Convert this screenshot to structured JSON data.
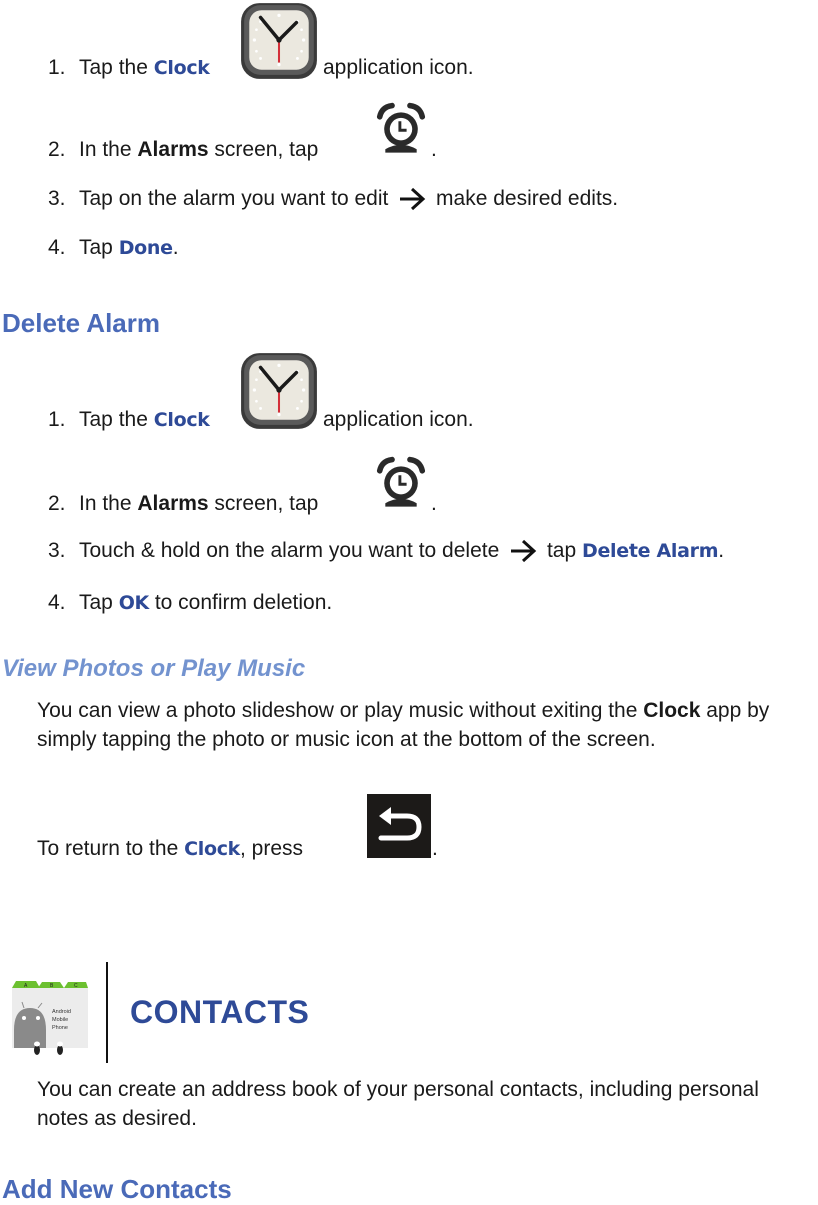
{
  "edit_alarm_steps": [
    {
      "num": "1.",
      "pre": "Tap the ",
      "key": "Clock",
      "icon": "clock-app-icon",
      "post": " application icon."
    },
    {
      "num": "2.",
      "pre": "In the ",
      "bold": "Alarms",
      "mid": " screen, tap ",
      "icon": "alarm-clock-icon",
      "post": "."
    },
    {
      "num": "3.",
      "pre": "Tap on the alarm you want to edit ",
      "icon": "arrow-right-icon",
      "post": " make desired edits."
    },
    {
      "num": "4.",
      "pre": "Tap ",
      "key": "Done",
      "post": "."
    }
  ],
  "delete_alarm": {
    "heading": "Delete Alarm",
    "steps": [
      {
        "num": "1.",
        "pre": "Tap the ",
        "key": "Clock",
        "icon": "clock-app-icon",
        "post": " application icon."
      },
      {
        "num": "2.",
        "pre": "In the ",
        "bold": "Alarms",
        "mid": " screen, tap ",
        "icon": "alarm-clock-icon",
        "post": "."
      },
      {
        "num": "3.",
        "pre": "Touch & hold on the alarm you want to delete ",
        "icon": "arrow-right-icon",
        "mid": " tap ",
        "key": "Delete Alarm",
        "post": "."
      },
      {
        "num": "4.",
        "pre": "Tap ",
        "key": "OK",
        "post": " to confirm deletion."
      }
    ]
  },
  "view_photos": {
    "heading": "View Photos or Play Music",
    "para_pre": "You can view a photo slideshow or play music without exiting the ",
    "para_bold": "Clock",
    "para_post": " app by simply tapping the photo or music icon at the bottom of the screen.",
    "return_pre": "To return to the ",
    "return_key": "Clock",
    "return_mid": ", press ",
    "return_icon": "back-button-icon",
    "return_post": "."
  },
  "contacts": {
    "title": "CONTACTS",
    "icon": "contacts-app-icon",
    "icon_tabs": [
      "A",
      "B",
      "C"
    ],
    "icon_label": [
      "Android",
      "Mobile",
      "Phone"
    ],
    "para": "You can create an address book of your personal contacts, including personal notes as desired.",
    "next_heading": "Add New Contacts"
  },
  "colors": {
    "key_blue": "#2e4a97",
    "heading_blue": "#4a6ab8",
    "subheading_blue": "#7393cf",
    "text": "#1a1a1a"
  }
}
